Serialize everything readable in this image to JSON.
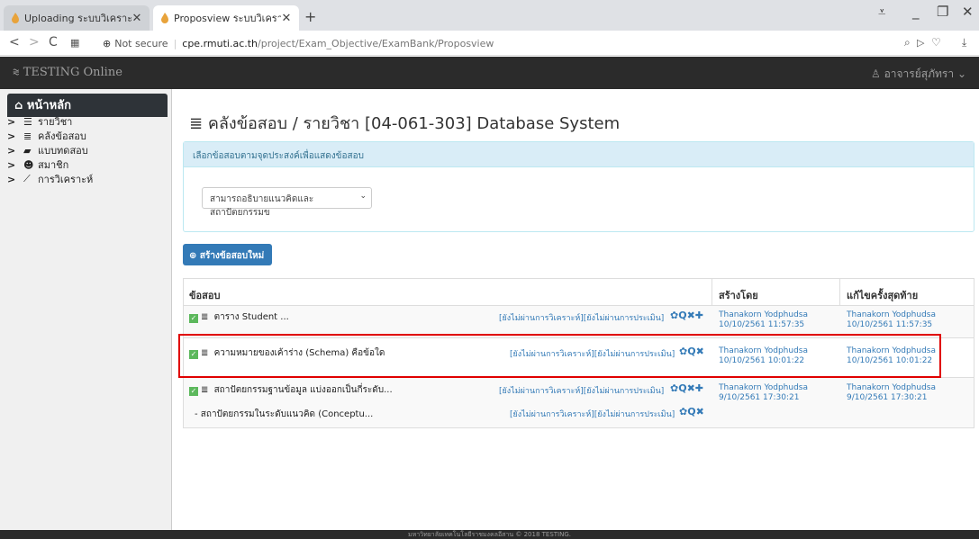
{
  "browser": {
    "tabs": [
      {
        "title": "Uploading ระบบวิเคราะห์ข้อ"
      },
      {
        "title": "Proposview ระบบวิเคราะห์ข้อ"
      }
    ],
    "new_tab": "+",
    "address": {
      "security": "Not secure",
      "host": "cpe.rmuti.ac.th",
      "path": "/project/Exam_Objective/ExamBank/Proposview"
    }
  },
  "app": {
    "brand": "TESTING Online",
    "user": "อาจารย์สุภัทรา"
  },
  "sidebar": {
    "home": "หน้าหลัก",
    "items": [
      {
        "label": "รายวิชา",
        "icon": "list-icon"
      },
      {
        "label": "คลังข้อสอบ",
        "icon": "database-icon"
      },
      {
        "label": "แบบทดสอบ",
        "icon": "book-icon"
      },
      {
        "label": "สมาชิก",
        "icon": "users-icon"
      },
      {
        "label": "การวิเคราะห์",
        "icon": "chart-icon"
      }
    ]
  },
  "main": {
    "title": "คลังข้อสอบ / รายวิชา [04-061-303] Database System",
    "filter_panel": {
      "heading": "เลือกข้อสอบตามจุดประสงค์เพื่อแสดงข้อสอบ",
      "selected": "สามารถอธิบายแนวคิดและสถาปัตยกรรมข"
    },
    "new_button": "สร้างข้อสอบใหม่",
    "table": {
      "headers": [
        "ข้อสอบ",
        "สร้างโดย",
        "แก้ไขครั้งสุดท้าย"
      ],
      "rows": [
        {
          "question": "ตาราง Student ...",
          "status": "[ยังไม่ผ่านการวิเคราะห์][ยังไม่ผ่านการประเมิน]",
          "created_by": "Thanakorn Yodphudsa",
          "created_at": "10/10/2561 11:57:35",
          "edited_by": "Thanakorn Yodphudsa",
          "edited_at": "10/10/2561 11:57:35"
        },
        {
          "question": "ความหมายของเค้าร่าง (Schema) คือข้อใด",
          "status": "[ยังไม่ผ่านการวิเคราะห์][ยังไม่ผ่านการประเมิน]",
          "created_by": "Thanakorn Yodphudsa",
          "created_at": "10/10/2561 10:01:22",
          "edited_by": "Thanakorn Yodphudsa",
          "edited_at": "10/10/2561 10:01:22"
        },
        {
          "question": "สถาปัตยกรรมฐานข้อมูล แบ่งออกเป็นกี่ระดับ...",
          "status": "[ยังไม่ผ่านการวิเคราะห์][ยังไม่ผ่านการประเมิน]",
          "created_by": "Thanakorn Yodphudsa",
          "created_at": "9/10/2561 17:30:21",
          "edited_by": "Thanakorn Yodphudsa",
          "edited_at": "9/10/2561 17:30:21",
          "sub": {
            "question": "- สถาปัตยกรรมในระดับแนวคิด (Conceptu...",
            "status": "[ยังไม่ผ่านการวิเคราะห์][ยังไม่ผ่านการประเมิน]"
          }
        }
      ]
    }
  },
  "footer": "มหาวิทยาลัยเทคโนโลยีราชมงคลอีสาน © 2018 TESTING."
}
